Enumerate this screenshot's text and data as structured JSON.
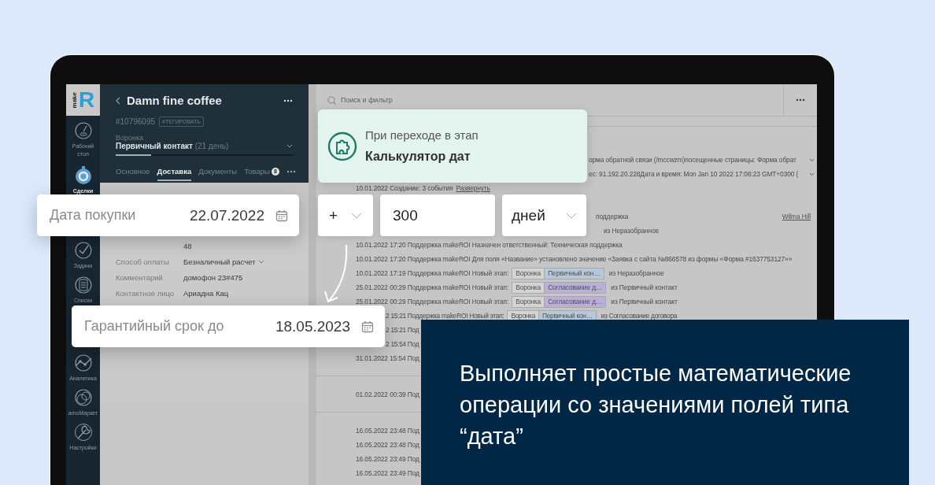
{
  "sidebar": {
    "logo": {
      "small": "make",
      "big": "R"
    },
    "items": [
      {
        "label": "Рабочий стол",
        "kind": "gauge",
        "selected": false
      },
      {
        "label": "Сделки",
        "kind": "coin",
        "selected": true
      },
      {
        "label": "Задачи",
        "kind": "tasks",
        "selected": false
      },
      {
        "label": "Списки",
        "kind": "lists",
        "selected": false
      },
      {
        "label": "Аналитика",
        "kind": "analytics",
        "selected": false
      },
      {
        "label": "amoМаркет",
        "kind": "market",
        "selected": false
      },
      {
        "label": "Настройки",
        "kind": "settings",
        "selected": false
      }
    ]
  },
  "lead": {
    "title": "Damn fine coffee",
    "id": "#10796095",
    "tag_button": "#ТЕГИРОВАТЬ",
    "pipeline_label": "Воронка",
    "stage": "Первичный контакт",
    "stage_duration": "(21 день)",
    "stage_progress": {
      "level": 0.2
    },
    "tabs": [
      {
        "label": "Основное",
        "selected": false
      },
      {
        "label": "Доставка",
        "selected": true
      },
      {
        "label": "Документы",
        "selected": false
      },
      {
        "label": "Товары",
        "selected": false,
        "badge": "8"
      }
    ],
    "fields": [
      {
        "value": "48",
        "kind": "text"
      },
      {
        "label": "Способ оплаты",
        "value": "Безналичный расчет",
        "kind": "select"
      },
      {
        "label": "Комментарий",
        "value": "домофон 23#475",
        "kind": "text"
      },
      {
        "label": "Контактное лицо",
        "value": "Ариадна Кац",
        "kind": "text"
      }
    ]
  },
  "feed": {
    "search": {
      "placeholder": "Поиск и фильтр"
    },
    "sections": [
      {
        "rows": [
          {
            "text": "орма обратной связи (/mccwzm)посещенные страницы: Форма обрат",
            "kind": "after-trigger",
            "expandable": true
          },
          {
            "text": "ес: 91.192.20.228Дата и время: Mon Jan 10 2022 17:06:23 GMT+0300 (",
            "kind": "after-trigger",
            "expandable": true
          },
          {
            "text": "10.01.2022 Создание: 3 события",
            "link": "Развернуть"
          },
          {
            "text": "поддержка",
            "kind": "after-fields",
            "assignee": "Wilma Hill"
          },
          {
            "text": "из Неразобранное",
            "kind": "after-fields"
          },
          {
            "text": "10.01.2022 17:20 Поддержка makeROI Назначен ответственный: Техническая поддержка"
          },
          {
            "text": "10.01.2022 17:20 Поддержка makeROI Для поля «Название» установлено значение «Заявка с сайта №866578 из формы «Форма #1637753127»»"
          },
          {
            "text": "10.01.2022 17:19 Поддержка makeROI Новый этап:",
            "tags": [
              {
                "label": "Воронка",
                "color": "#d4d4d4"
              },
              {
                "label": "Первичный кон…",
                "color": "#b6c8d9"
              }
            ],
            "text_after": "из Неразобранное"
          },
          {
            "text": "25.01.2022 00:29 Поддержка makeROI Новый этап:",
            "tags": [
              {
                "label": "Воронка",
                "color": "#d4d4d4"
              },
              {
                "label": "Согласование д…",
                "color": "#b8b0d6"
              }
            ],
            "text_after": "из Первичный контакт"
          },
          {
            "text": "25.01.2022 00:29 Поддержка makeROI Новый этап:",
            "tags": [
              {
                "label": "Воронка",
                "color": "#d4d4d4"
              },
              {
                "label": "Согласование д…",
                "color": "#b8b0d6"
              }
            ],
            "text_after": "из Первичный контакт"
          },
          {
            "text": "2 15:21 Поддержка makeROI Новый этап:",
            "kind": "after-card",
            "tags": [
              {
                "label": "Воронка",
                "color": "#d4d4d4"
              },
              {
                "label": "Первичный кон…",
                "color": "#b6c8d9"
              }
            ],
            "text_after": "из Согласование договора"
          },
          {
            "text": "2 15:21 Под",
            "kind": "after-card"
          },
          {
            "text": "2 15:54 Под",
            "kind": "after-card"
          },
          {
            "text": "31.01.2022 15:54 Под"
          }
        ]
      },
      {
        "rows": [
          {
            "text": "01.02.2022 00:39 Под"
          }
        ]
      },
      {
        "rows": [
          {
            "text": "16.05.2022 23:48 Под"
          },
          {
            "text": "16.05.2022 23:48 Под"
          },
          {
            "text": "16.05.2022 23:49 Под"
          },
          {
            "text": "16.05.2022 23:49 Под"
          }
        ]
      }
    ]
  },
  "overlays": {
    "purchase_date": {
      "label": "Дата покупки",
      "value": "22.07.2022"
    },
    "trigger": {
      "caption": "При переходе в этап",
      "title": "Калькулятор дат"
    },
    "calc": {
      "operator": "+",
      "amount": "300",
      "unit": "дней"
    },
    "warranty_date": {
      "label": "Гарантийный срок до",
      "value": "18.05.2023"
    },
    "promo": {
      "text": "Выполняет простые математические операции со значениями полей типа “дата”"
    }
  }
}
